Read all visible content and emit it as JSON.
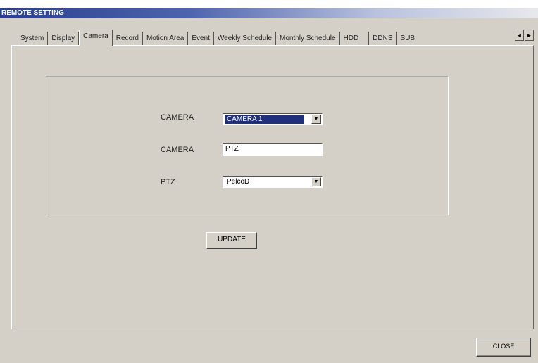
{
  "window": {
    "title": "REMOTE SETTING"
  },
  "tabs": [
    {
      "label": "System"
    },
    {
      "label": "Display"
    },
    {
      "label": "Camera",
      "active": true
    },
    {
      "label": "Record"
    },
    {
      "label": "Motion Area"
    },
    {
      "label": "Event"
    },
    {
      "label": "Weekly Schedule"
    },
    {
      "label": "Monthly Schedule"
    },
    {
      "label": "HDD"
    },
    {
      "label": "DDNS"
    },
    {
      "label": "SUB"
    }
  ],
  "tab_scroll": {
    "left": "◄",
    "right": "►"
  },
  "form": {
    "camera_select_label": "CAMERA",
    "camera_select_value": "CAMERA 1",
    "camera_name_label": "CAMERA",
    "camera_name_value": "PTZ",
    "ptz_label": "PTZ",
    "ptz_value": "PelcoD"
  },
  "buttons": {
    "update": "UPDATE",
    "close": "CLOSE"
  },
  "icons": {
    "dropdown": "▼"
  }
}
